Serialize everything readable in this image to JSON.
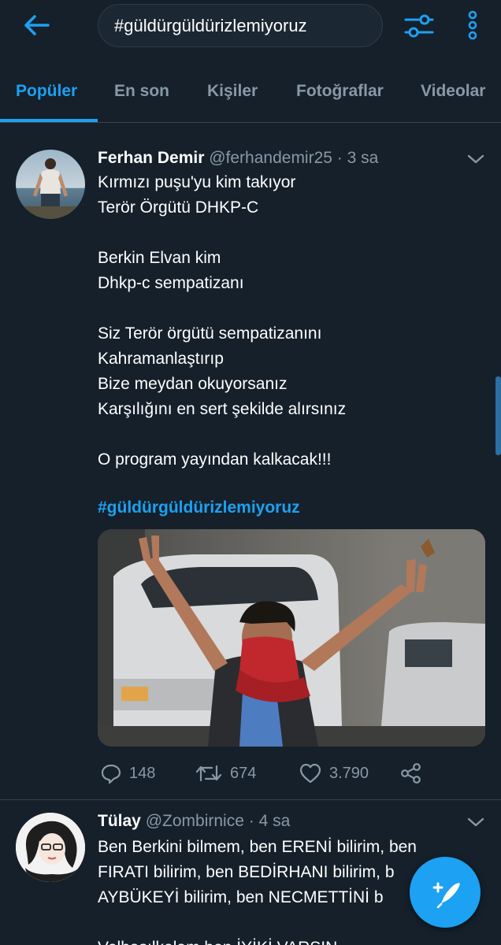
{
  "header": {
    "search_value": "#güldürgüldürizlemiyoruz",
    "back_icon": "arrow-left-icon",
    "filter_icon": "sliders-icon",
    "more_icon": "vertical-dots-icon",
    "accent_color": "#1da1f2"
  },
  "tabs": [
    {
      "label": "Popüler",
      "active": true
    },
    {
      "label": "En son",
      "active": false
    },
    {
      "label": "Kişiler",
      "active": false
    },
    {
      "label": "Fotoğraflar",
      "active": false
    },
    {
      "label": "Videolar",
      "active": false
    }
  ],
  "tweets": [
    {
      "name": "Ferhan Demir",
      "handle": "@ferhandemir25",
      "separator": "·",
      "time": "3 sa",
      "text": "Kırmızı puşu'yu kim takıyor\nTerör Örgütü DHKP-C\n\nBerkin Elvan kim\nDhkp-c sempatizanı\n\nSiz Terör örgütü sempatizanını\nKahramanlaştırıp\nBize meydan okuyorsanız\nKarşılığını en sert şekilde alırsınız\n\nO program yayından kalkacak!!!",
      "hashtag": "#güldürgüldürizlemiyoruz",
      "replies": "148",
      "retweets": "674",
      "likes": "3.790"
    },
    {
      "name": "Tülay",
      "handle": "@Zombirnice",
      "separator": "·",
      "time": "4 sa",
      "text": "Ben Berkini bilmem, ben ERENİ bilirim, ben\nFIRATI bilirim, ben BEDİRHANI bilirim, b\nAYBÜKEYİ bilirim, ben NECMETTİNİ b\n\nVelhasılkelam ben İYİKİ VARSIN"
    }
  ],
  "fab": {
    "icon": "compose-feather-plus-icon"
  }
}
